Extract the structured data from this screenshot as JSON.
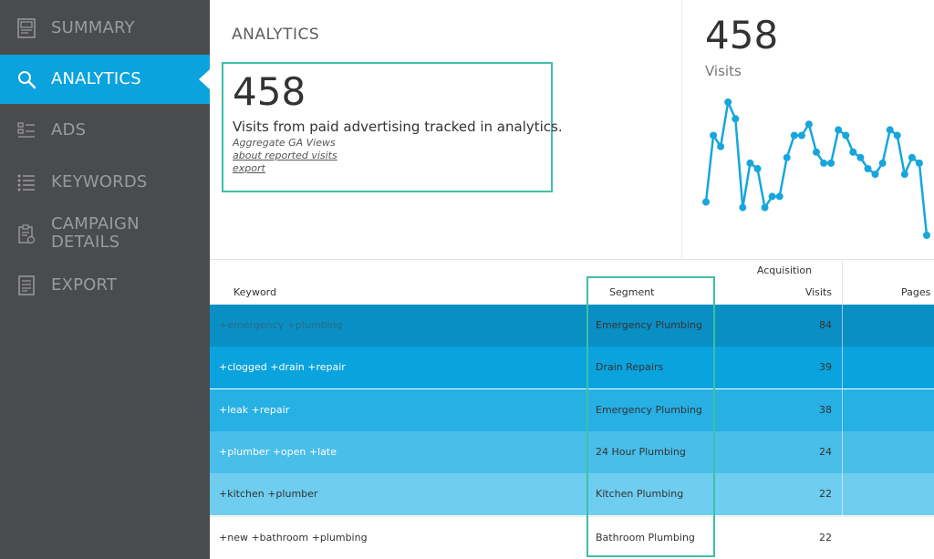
{
  "sidebar": {
    "items": [
      {
        "label": "SUMMARY",
        "icon": "report-icon",
        "active": false
      },
      {
        "label": "ANALYTICS",
        "icon": "search-icon",
        "active": true
      },
      {
        "label": "ADS",
        "icon": "list-icon",
        "active": false
      },
      {
        "label": "KEYWORDS",
        "icon": "bulleted-list-icon",
        "active": false
      },
      {
        "label_line1": "CAMPAIGN",
        "label_line2": "DETAILS",
        "icon": "clipboard-icon",
        "active": false
      },
      {
        "label": "EXPORT",
        "icon": "document-icon",
        "active": false
      }
    ]
  },
  "header": {
    "title": "ANALYTICS"
  },
  "summary": {
    "visits_number": "458",
    "visits_description": "Visits from paid advertising tracked in analytics.",
    "aggregate_label": "Aggregate GA Views",
    "about_link": "about reported visits",
    "export_link": "export"
  },
  "sparkline_panel": {
    "number": "458",
    "label": "Visits"
  },
  "chart_data": {
    "type": "line",
    "values": [
      7,
      19,
      17,
      25,
      22,
      6,
      14,
      13,
      6,
      8,
      8,
      15,
      19,
      19,
      21,
      16,
      14,
      14,
      20,
      19,
      16,
      15,
      13,
      12,
      14,
      20,
      19,
      12,
      15,
      14,
      1
    ],
    "color": "#17a6dc"
  },
  "table": {
    "group_header": "Acquisition",
    "headers": {
      "keyword": "Keyword",
      "segment": "Segment",
      "visits": "Visits",
      "pages": "Pages"
    },
    "rows": [
      {
        "keyword": "+emergency +plumbing",
        "segment": "Emergency Plumbing",
        "visits": "84",
        "bg": "#0a8fc4",
        "fg": "#2a6b86"
      },
      {
        "keyword": "+clogged +drain +repair",
        "segment": "Drain Repairs",
        "visits": "39",
        "bg": "#0aa3dd",
        "fg": "#ffffff"
      },
      {
        "keyword": "+leak +repair",
        "segment": "Emergency Plumbing",
        "visits": "38",
        "bg": "#26b0e4",
        "fg": "#ffffff"
      },
      {
        "keyword": "+plumber +open +late",
        "segment": "24 Hour Plumbing",
        "visits": "24",
        "bg": "#49bee9",
        "fg": "#ffffff"
      },
      {
        "keyword": "+kitchen +plumber",
        "segment": "Kitchen Plumbing",
        "visits": "22",
        "bg": "#6fcdef",
        "fg": "#333333"
      },
      {
        "keyword": "+new +bathroom +plumbing",
        "segment": "Bathroom Plumbing",
        "visits": "22",
        "bg": "#ffffff",
        "fg": "#333333"
      }
    ]
  }
}
